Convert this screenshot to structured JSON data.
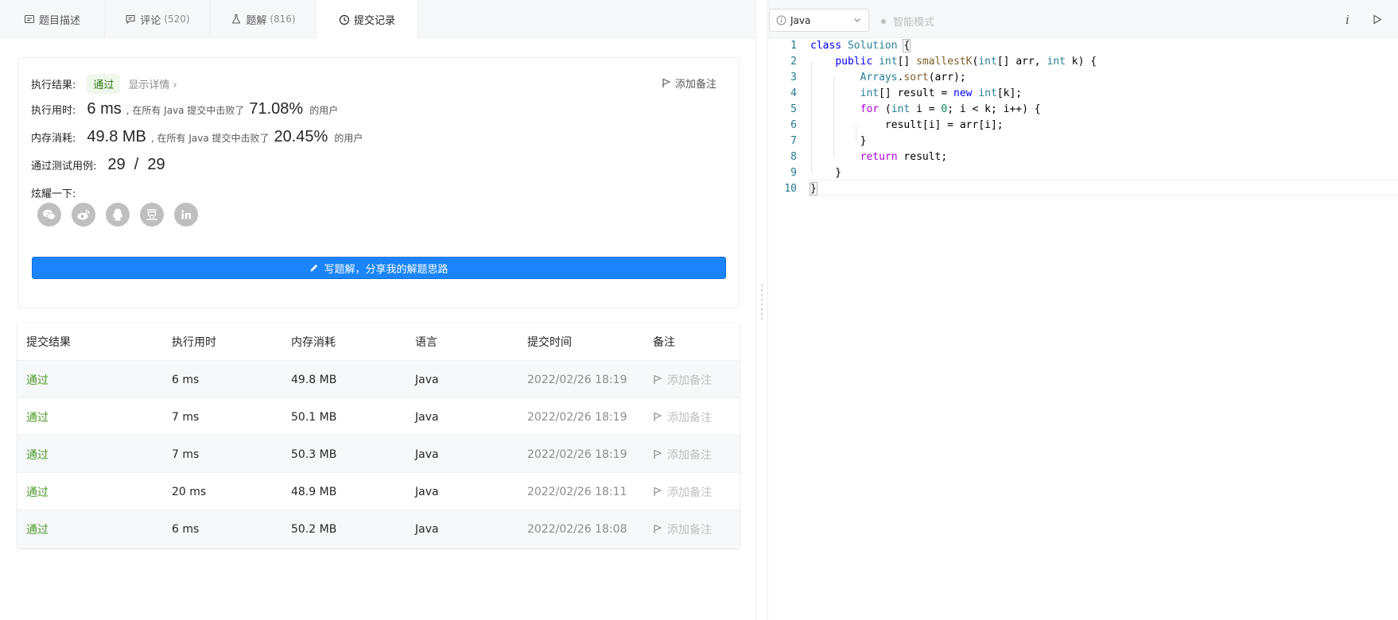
{
  "tabs": [
    {
      "label": "题目描述",
      "count": ""
    },
    {
      "label": "评论",
      "count": "(520)"
    },
    {
      "label": "题解",
      "count": "(816)"
    },
    {
      "label": "提交记录",
      "count": ""
    }
  ],
  "result": {
    "exec_result_label": "执行结果:",
    "status": "通过",
    "details_link": "显示详情 ›",
    "add_note": "添加备注",
    "runtime_label": "执行用时:",
    "runtime_value": "6 ms",
    "runtime_text": ", 在所有 Java 提交中击败了",
    "runtime_pct": "71.08%",
    "runtime_suffix": "的用户",
    "memory_label": "内存消耗:",
    "memory_value": "49.8 MB",
    "memory_text": ", 在所有 Java 提交中击败了",
    "memory_pct": "20.45%",
    "memory_suffix": "的用户",
    "tests_label": "通过测试用例:",
    "tests_value": "29  /  29",
    "share_label": "炫耀一下:",
    "share_icons": [
      "wechat-icon",
      "weibo-icon",
      "qq-icon",
      "douban-icon",
      "linkedin-icon"
    ],
    "write_solution": "写题解，分享我的解题思路"
  },
  "table": {
    "headers": [
      "提交结果",
      "执行用时",
      "内存消耗",
      "语言",
      "提交时间",
      "备注"
    ],
    "rows": [
      {
        "result": "通过",
        "runtime": "6 ms",
        "memory": "49.8 MB",
        "lang": "Java",
        "time": "2022/02/26 18:19",
        "note": "添加备注"
      },
      {
        "result": "通过",
        "runtime": "7 ms",
        "memory": "50.1 MB",
        "lang": "Java",
        "time": "2022/02/26 18:19",
        "note": "添加备注"
      },
      {
        "result": "通过",
        "runtime": "7 ms",
        "memory": "50.3 MB",
        "lang": "Java",
        "time": "2022/02/26 18:19",
        "note": "添加备注"
      },
      {
        "result": "通过",
        "runtime": "20 ms",
        "memory": "48.9 MB",
        "lang": "Java",
        "time": "2022/02/26 18:11",
        "note": "添加备注"
      },
      {
        "result": "通过",
        "runtime": "6 ms",
        "memory": "50.2 MB",
        "lang": "Java",
        "time": "2022/02/26 18:08",
        "note": "添加备注"
      }
    ]
  },
  "editor": {
    "language": "Java",
    "smart_mode": "智能模式",
    "info": "i",
    "line_numbers": [
      "1",
      "2",
      "3",
      "4",
      "5",
      "6",
      "7",
      "8",
      "9",
      "10"
    ],
    "code": [
      "class Solution {",
      "    public int[] smallestK(int[] arr, int k) {",
      "        Arrays.sort(arr);",
      "        int[] result = new int[k];",
      "        for (int i = 0; i < k; i++) {",
      "            result[i] = arr[i];",
      "        }",
      "        return result;",
      "    }",
      "}"
    ]
  },
  "colors": {
    "accent_blue": "#1a84f8",
    "pass_green": "#4c9a2a",
    "keyword": "#0000ff",
    "type": "#267f99",
    "function": "#795e26",
    "control": "#af00db",
    "number": "#098658",
    "line_number": "#237893"
  }
}
